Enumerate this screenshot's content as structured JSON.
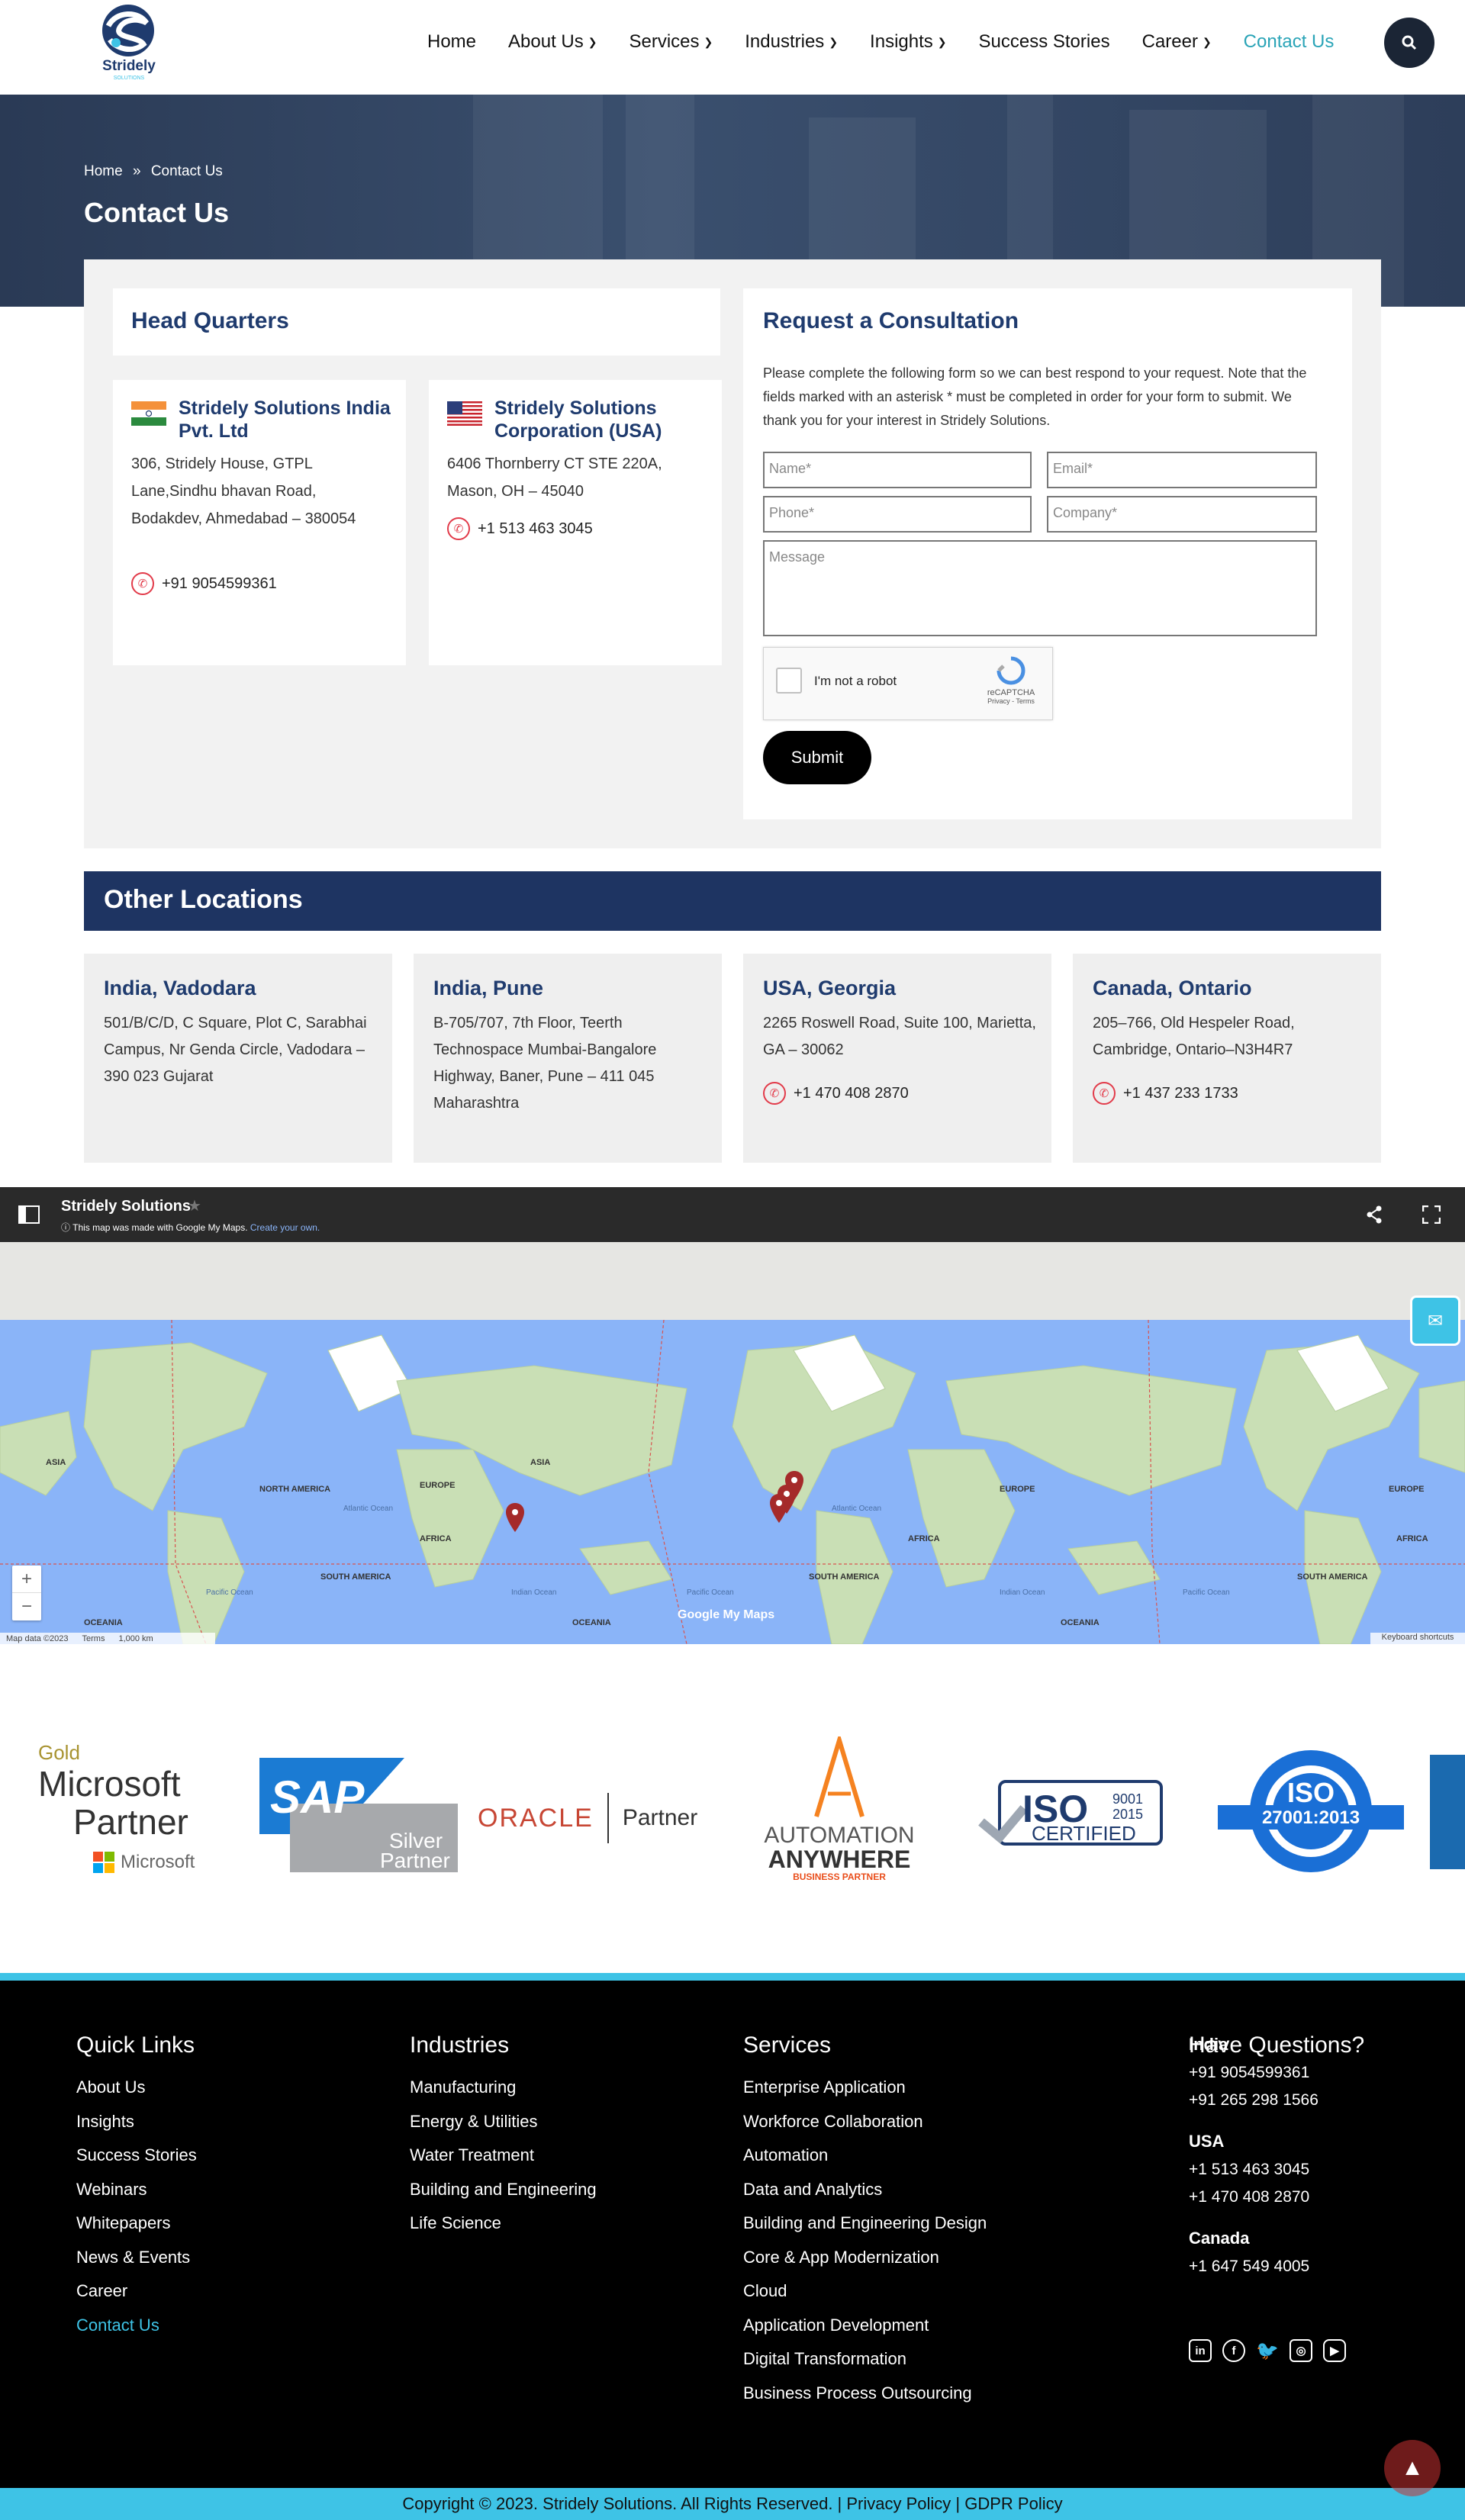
{
  "brand": {
    "name": "Stridely",
    "sub": "SOLUTIONS"
  },
  "nav": [
    {
      "label": "Home",
      "dropdown": false
    },
    {
      "label": "About Us",
      "dropdown": true
    },
    {
      "label": "Services",
      "dropdown": true
    },
    {
      "label": "Industries",
      "dropdown": true
    },
    {
      "label": "Insights",
      "dropdown": true
    },
    {
      "label": "Success Stories",
      "dropdown": false
    },
    {
      "label": "Career",
      "dropdown": true
    },
    {
      "label": "Contact Us",
      "dropdown": false,
      "active": true
    }
  ],
  "breadcrumb": {
    "home": "Home",
    "sep": "»",
    "current": "Contact Us"
  },
  "page_title": "Contact Us",
  "hq": {
    "title": "Head Quarters",
    "india": {
      "name": "Stridely Solutions India Pvt. Ltd",
      "address": "306, Stridely House, GTPL Lane,Sindhu bhavan Road, Bodakdev, Ahmedabad – 380054",
      "phone": "+91 9054599361"
    },
    "usa": {
      "name": "Stridely Solutions Corporation (USA)",
      "address": "6406 Thornberry CT STE 220A, Mason, OH – 45040",
      "phone": "+1 513 463 3045"
    }
  },
  "form": {
    "title": "Request a Consultation",
    "intro": "Please complete the following form so we can best respond to your request. Note that the fields marked with an asterisk * must be completed in order for your form to submit. We thank you for your interest in Stridely Solutions.",
    "name": "Name*",
    "email": "Email*",
    "phone": "Phone*",
    "company": "Company*",
    "message": "Message",
    "captcha": "I'm not a robot",
    "captcha_brand": "reCAPTCHA",
    "captcha_links": "Privacy - Terms",
    "submit": "Submit"
  },
  "other": {
    "title": "Other Locations",
    "items": [
      {
        "city": "India, Vadodara",
        "address": "501/B/C/D, C Square, Plot C, Sarabhai Campus, Nr Genda Circle, Vadodara – 390 023 Gujarat",
        "phone": ""
      },
      {
        "city": "India, Pune",
        "address": "B-705/707, 7th Floor, Teerth Technospace Mumbai-Bangalore Highway, Baner, Pune – 411 045 Maharashtra",
        "phone": ""
      },
      {
        "city": "USA, Georgia",
        "address": "2265 Roswell Road, Suite 100, Marietta, GA – 30062",
        "phone": "+1 470 408 2870"
      },
      {
        "city": "Canada, Ontario",
        "address": "205–766, Old Hespeler Road, Cambridge, Ontario–N3H4R7",
        "phone": "+1 437 233 1733"
      }
    ]
  },
  "map": {
    "title": "Stridely Solutions",
    "note": "This map was made with Google My Maps.",
    "create": "Create your own.",
    "credit": "Map data ©2023",
    "terms": "Terms",
    "scale": "1,000 km",
    "shortcuts": "Keyboard shortcuts",
    "watermark": "Google My Maps",
    "labels": {
      "asia": "ASIA",
      "europe": "EUROPE",
      "africa": "AFRICA",
      "north_america": "NORTH AMERICA",
      "south_america": "SOUTH AMERICA",
      "oceania": "OCEANIA",
      "atlantic": "Atlantic Ocean",
      "pacific": "Pacific Ocean",
      "indian": "Indian Ocean"
    }
  },
  "partners": {
    "ms_gold": "Gold",
    "ms_partner1": "Microsoft",
    "ms_partner2": "Partner",
    "ms_brand": "Microsoft",
    "sap": "SAP",
    "sap_silver": "Silver",
    "sap_partner": "Partner",
    "oracle": "ORACLE",
    "oracle_partner": "Partner",
    "aa1": "AUTOMATION",
    "aa2": "ANYWHERE",
    "aa3": "BUSINESS PARTNER",
    "iso": "ISO",
    "iso_nums1": "9001",
    "iso_nums2": "2015",
    "iso_cert": "CERTIFIED",
    "iso2": "ISO",
    "iso2_num": "27001:2013"
  },
  "footer": {
    "quick": {
      "title": "Quick Links",
      "items": [
        "About Us",
        "Insights",
        "Success Stories",
        "Webinars",
        "Whitepapers",
        "News & Events",
        "Career",
        "Contact Us"
      ]
    },
    "industries": {
      "title": "Industries",
      "items": [
        "Manufacturing",
        "Energy & Utilities",
        "Water Treatment",
        "Building and Engineering",
        "Life Science"
      ]
    },
    "services": {
      "title": "Services",
      "items": [
        "Enterprise Application",
        "Workforce Collaboration",
        "Automation",
        "Data and Analytics",
        "Building and Engineering Design",
        "Core & App Modernization",
        "Cloud",
        "Application Development",
        "Digital Transformation",
        "Business Process Outsourcing"
      ]
    },
    "questions": {
      "title": "Have Questions?",
      "india": "India",
      "india_p1": "+91 9054599361",
      "india_p2": "+91 265 298 1566",
      "usa": "USA",
      "usa_p1": "+1 513 463 3045",
      "usa_p2": "+1 470 408 2870",
      "canada": "Canada",
      "canada_p1": "+1 647 549 4005"
    },
    "copyright": "Copyright © 2023. Stridely Solutions. All Rights Reserved. | Privacy Policy | GDPR Policy"
  },
  "colors": {
    "navy": "#1f3b6e",
    "accent": "#3ec3e6",
    "active": "#2aa4b7",
    "phone": "#e23b4a"
  }
}
